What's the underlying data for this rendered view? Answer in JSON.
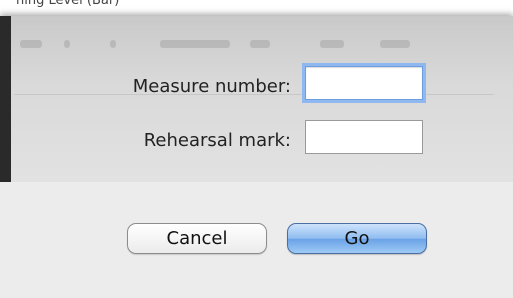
{
  "background_title": "ning Level (Bar)",
  "dialog": {
    "fields": [
      {
        "label": "Measure number:",
        "value": "",
        "placeholder": ""
      },
      {
        "label": "Rehearsal mark:",
        "value": "",
        "placeholder": ""
      }
    ],
    "buttons": {
      "cancel_label": "Cancel",
      "go_label": "Go"
    }
  },
  "colors": {
    "focus_ring": "#8fb7f0",
    "default_button": "#6aa2e6",
    "dialog_background": "#ececec"
  }
}
